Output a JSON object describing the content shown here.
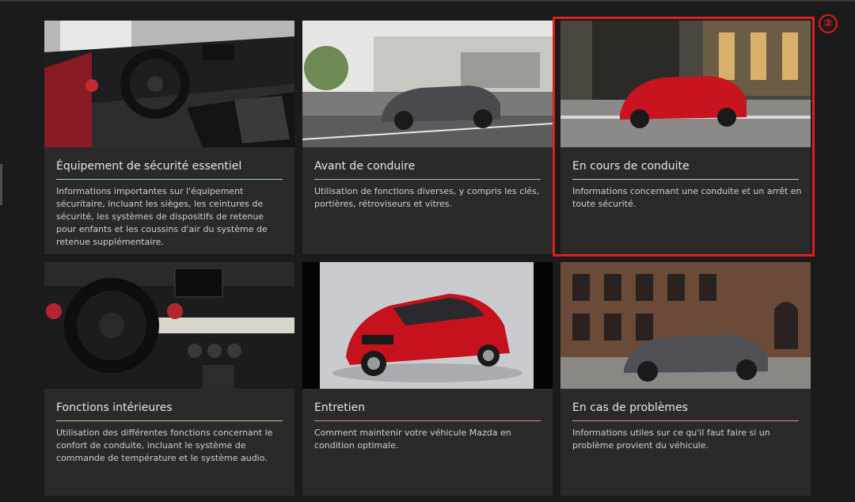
{
  "colors": {
    "background": "#1b1b1b",
    "card": "#2a2a2a",
    "highlight": "#e01e1e",
    "rule_safety": "#9fd3e6",
    "rule_before": "#b8b8b8",
    "rule_driving": "#cfcfcf",
    "rule_interior": "#c9d27a",
    "rule_maintenance": "#e0907a",
    "rule_problems": "#e08b8b"
  },
  "annotation": {
    "marker_label": "②"
  },
  "cards": [
    {
      "title": "Équipement de sécurité essentiel",
      "description": "Informations importantes sur l'équipement sécuritaire, incluant les sièges, les ceintures de sécurité, les systèmes de dispositifs de retenue pour enfants et les coussins d'air du système de retenue supplémentaire."
    },
    {
      "title": "Avant de conduire",
      "description": "Utilisation de fonctions diverses, y compris les clés, portières, rétroviseurs et vitres."
    },
    {
      "title": "En cours de conduite",
      "description": "Informations concernant une conduite et un arrêt en toute sécurité."
    },
    {
      "title": "Fonctions intérieures",
      "description": "Utilisation des différentes fonctions concernant le confort de conduite, incluant le système de commande de température et le système audio."
    },
    {
      "title": "Entretien",
      "description": "Comment maintenir votre véhicule Mazda en condition optimale."
    },
    {
      "title": "En cas de problèmes",
      "description": "Informations utiles sur ce qu'il faut faire si un problème provient du véhicule."
    }
  ]
}
